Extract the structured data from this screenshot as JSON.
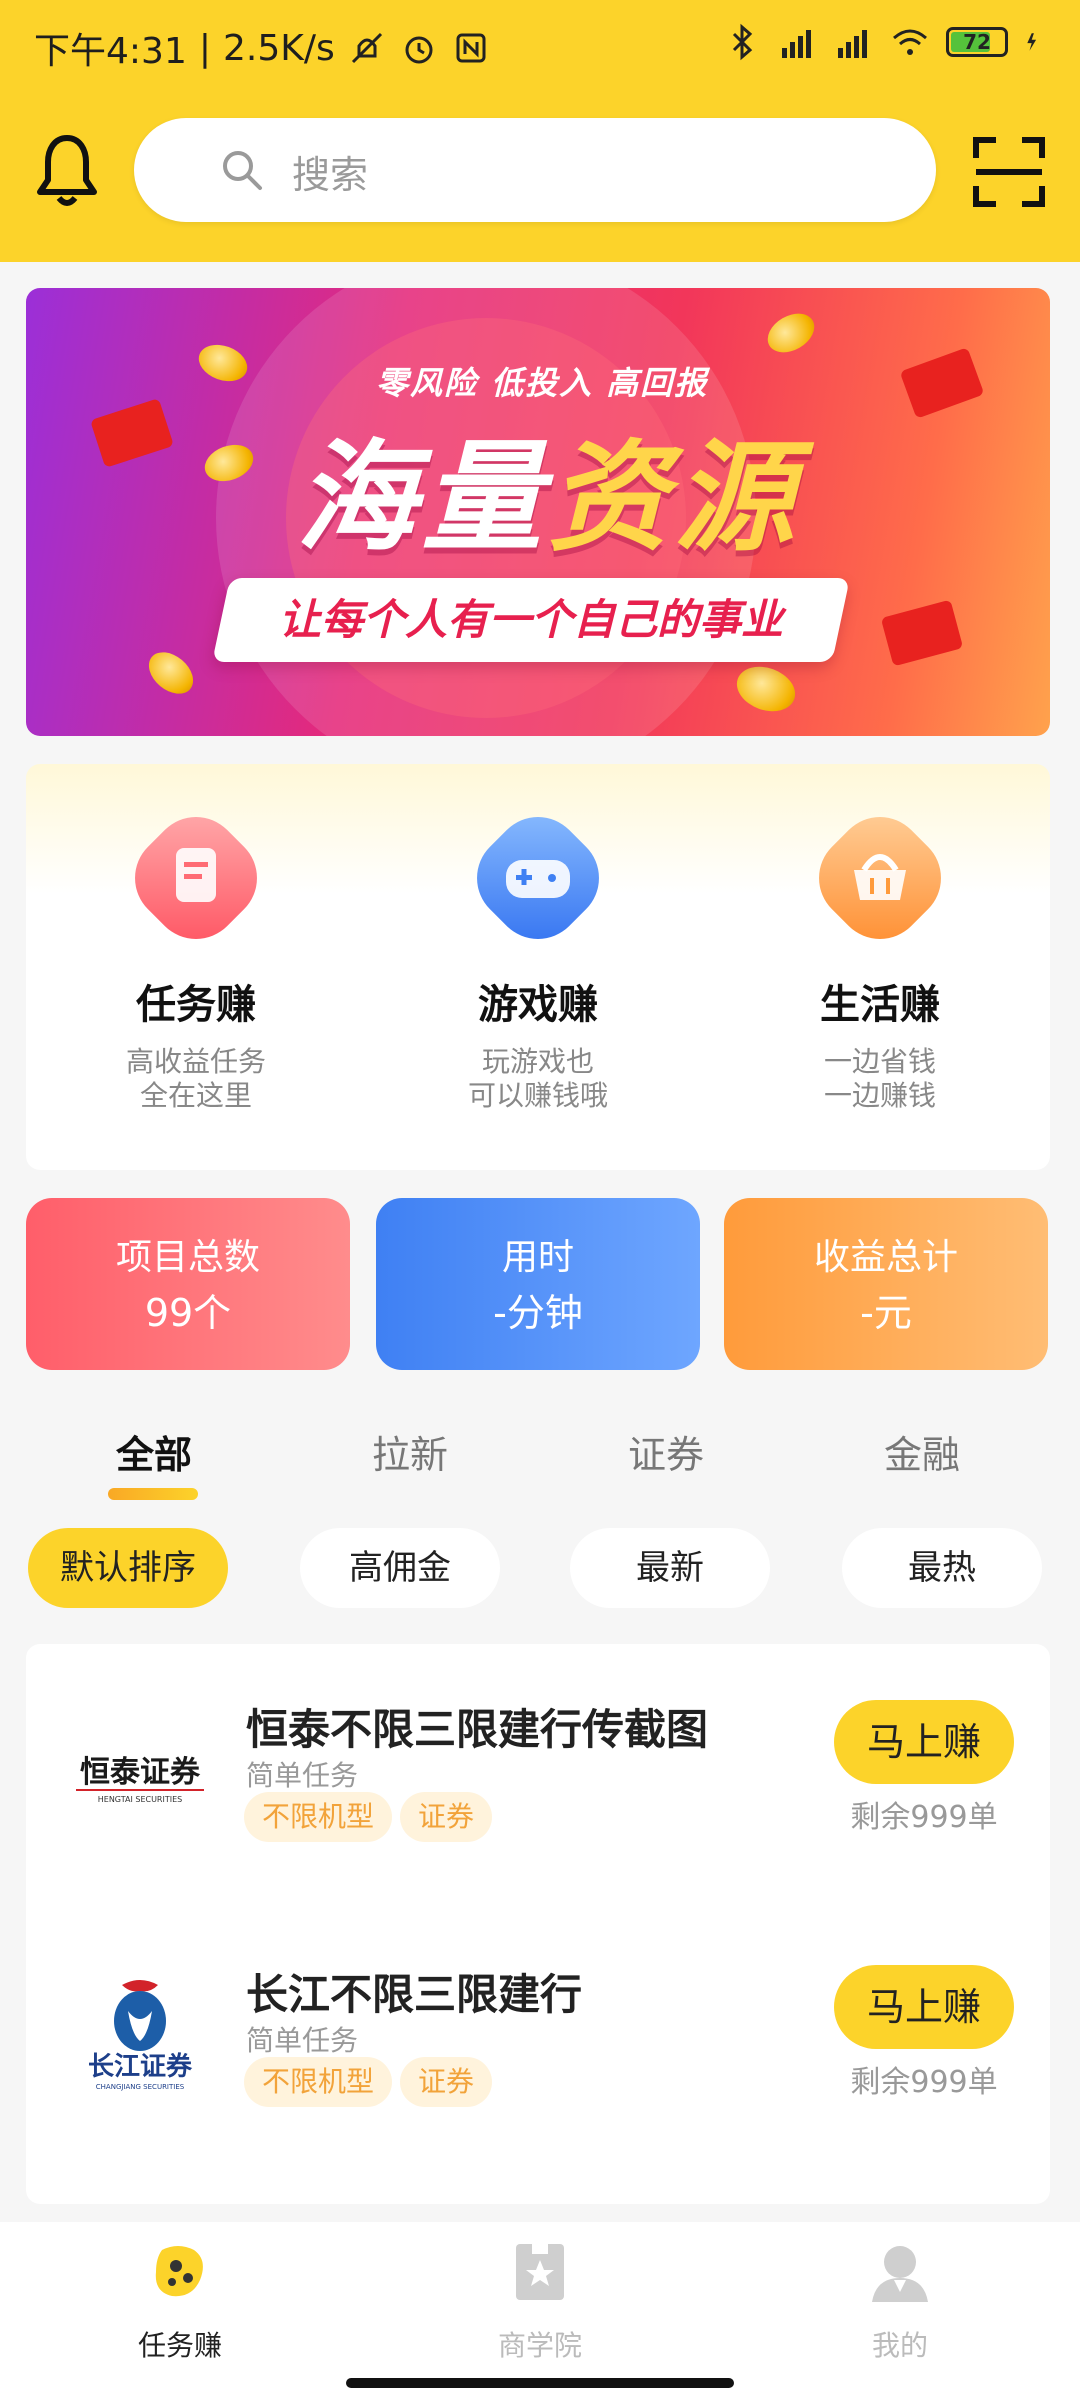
{
  "status_bar": {
    "time": "下午4:31",
    "network_speed": "2.5K/s",
    "battery": "72",
    "colors": {
      "battery_fill": "#55c23b"
    }
  },
  "header": {
    "search_placeholder": "搜索",
    "icons": [
      "bell-icon",
      "search-icon",
      "scan-icon"
    ],
    "colors": {
      "background": "#fcd32a"
    }
  },
  "banner": {
    "subtitle": "零风险  低投入  高回报",
    "title_part1": "海量",
    "title_part2": "资源",
    "tagline": "让每个人有一个自己的事业"
  },
  "categories": [
    {
      "name": "任务赚",
      "desc1": "高收益任务",
      "desc2": "全在这里",
      "icon": "task-icon"
    },
    {
      "name": "游戏赚",
      "desc1": "玩游戏也",
      "desc2": "可以赚钱哦",
      "icon": "gamepad-icon"
    },
    {
      "name": "生活赚",
      "desc1": "一边省钱",
      "desc2": "一边赚钱",
      "icon": "basket-icon"
    }
  ],
  "stats": [
    {
      "label": "项目总数",
      "value": "99个"
    },
    {
      "label": "用时",
      "value": "-分钟"
    },
    {
      "label": "收益总计",
      "value": "-元"
    }
  ],
  "tabs": [
    {
      "label": "全部",
      "active": true
    },
    {
      "label": "拉新",
      "active": false
    },
    {
      "label": "证券",
      "active": false
    },
    {
      "label": "金融",
      "active": false
    }
  ],
  "filters": [
    {
      "label": "默认排序",
      "active": true
    },
    {
      "label": "高佣金",
      "active": false
    },
    {
      "label": "最新",
      "active": false
    },
    {
      "label": "最热",
      "active": false
    }
  ],
  "tasks": [
    {
      "title": "恒泰不限三限建行传截图",
      "subtitle": "简单任务",
      "tags": [
        "不限机型",
        "证券"
      ],
      "button": "马上赚",
      "remaining": "剩余999单",
      "logo_text": "恒泰证券",
      "logo_sub": "HENGTAI SECURITIES"
    },
    {
      "title": "长江不限三限建行",
      "subtitle": "简单任务",
      "tags": [
        "不限机型",
        "证券"
      ],
      "button": "马上赚",
      "remaining": "剩余999单",
      "logo_text": "长江证券",
      "logo_sub": "CHANGJIANG SECURITIES"
    }
  ],
  "bottom_nav": [
    {
      "label": "任务赚",
      "active": true
    },
    {
      "label": "商学院",
      "active": false
    },
    {
      "label": "我的",
      "active": false
    }
  ]
}
